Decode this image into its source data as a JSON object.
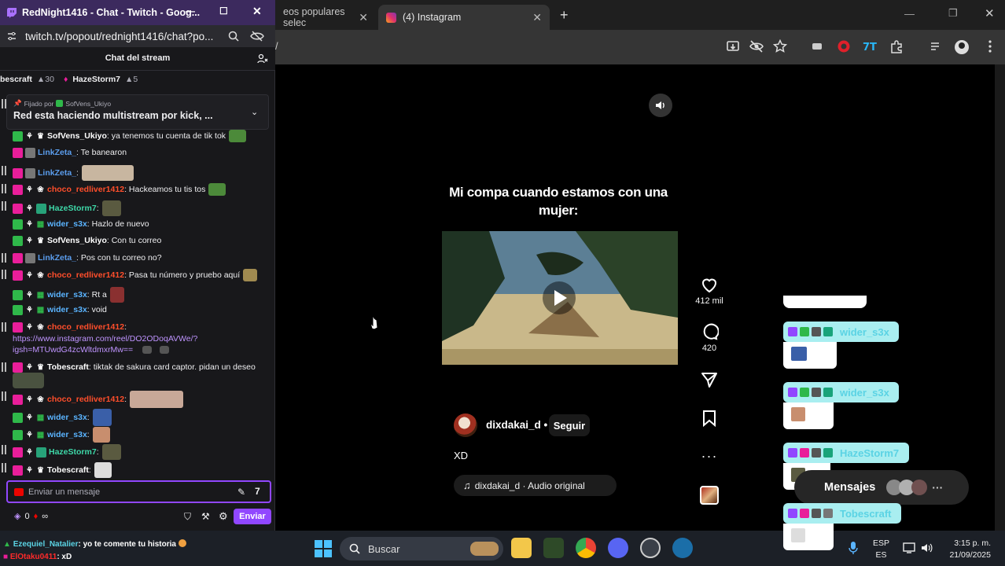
{
  "popout": {
    "title": "RedNight1416 - Chat - Twitch - Goog...",
    "url": "twitch.tv/popout/rednight1416/chat?po...",
    "chat_header": "Chat del stream",
    "leaderboard": [
      {
        "name": "bescraft",
        "count": "30"
      },
      {
        "name": "HazeStorm7",
        "count": "5"
      }
    ],
    "pinned": {
      "by_label": "Fijado por",
      "by_user": "SofVens_Ukiyo",
      "text": "Red esta haciendo multistream por kick, ..."
    },
    "messages": [
      {
        "user": "SofVens_Ukiyo",
        "color": "#ffffff",
        "text": ": ya tenemos tu cuenta de tik tok"
      },
      {
        "user": "LinkZeta_",
        "color": "#5b9ded",
        "text": ": Te banearon"
      },
      {
        "user": "LinkZeta_",
        "color": "#5b9ded",
        "text": ":"
      },
      {
        "user": "choco_redliver1412",
        "color": "#ff4e2b",
        "text": ": Hackeamos tu tis tos"
      },
      {
        "user": "HazeStorm7",
        "color": "#3ed8a8",
        "text": ":"
      },
      {
        "user": "wider_s3x",
        "color": "#5ab4ff",
        "text": ": Hazlo de nuevo"
      },
      {
        "user": "SofVens_Ukiyo",
        "color": "#ffffff",
        "text": ": Con tu correo"
      },
      {
        "user": "LinkZeta_",
        "color": "#5b9ded",
        "text": ": Pos con tu correo no?"
      },
      {
        "user": "choco_redliver1412",
        "color": "#ff4e2b",
        "text": ": Pasa tu número y pruebo aquí"
      },
      {
        "user": "wider_s3x",
        "color": "#5ab4ff",
        "text": ": Rt a"
      },
      {
        "user": "wider_s3x",
        "color": "#5ab4ff",
        "text": ": void"
      },
      {
        "user": "choco_redliver1412",
        "color": "#ff4e2b",
        "text": ":"
      },
      {
        "user": "Tobescraft",
        "color": "#ffffff",
        "text": ": tiktak de sakura card captor. pidan un deseo"
      },
      {
        "user": "choco_redliver1412",
        "color": "#ff4e2b",
        "text": ":"
      },
      {
        "user": "wider_s3x",
        "color": "#5ab4ff",
        "text": ":"
      },
      {
        "user": "wider_s3x",
        "color": "#5ab4ff",
        "text": ":"
      },
      {
        "user": "HazeStorm7",
        "color": "#3ed8a8",
        "text": ":"
      },
      {
        "user": "Tobescraft",
        "color": "#ffffff",
        "text": ":"
      }
    ],
    "link_line1": "https://www.instagram.com/reel/DO2ODoqAVWe/?",
    "link_line2": "igsh=MTUwdG4zcWltdmxrMw==",
    "input_placeholder": "Enviar un mensaje",
    "points": "0",
    "infinity": "∞",
    "send_label": "Enviar"
  },
  "browser": {
    "tabs": [
      {
        "label": "eos populares selec",
        "active": false
      },
      {
        "label": "(4) Instagram",
        "active": true
      }
    ],
    "address": "/"
  },
  "reel": {
    "caption": "Mi compa cuando estamos con una mujer:",
    "likes": "412 mil",
    "comments": "420",
    "author": "dixdakai_d",
    "dot": "•",
    "follow": "Seguir",
    "post_caption": "XD",
    "audio": "dixdakai_d · Audio original"
  },
  "overlay": {
    "names": [
      "wider_s3x",
      "wider_s3x",
      "HazeStorm7",
      "Tobescraft"
    ],
    "messages_label": "Mensajes"
  },
  "stream_chat": [
    {
      "user": "Ezequiel_Natalier",
      "text": ": yo te comente tu historia"
    },
    {
      "user": "ElOtaku0411",
      "text": ": xD"
    }
  ],
  "taskbar": {
    "search": "Buscar",
    "lang1": "ESP",
    "lang2": "ES",
    "time": "3:15 p. m.",
    "date": "21/09/2025"
  },
  "colors": {
    "twitch_purple": "#9147ff",
    "chrome_bg": "#353535",
    "title_bar": "#3c2a5e"
  }
}
